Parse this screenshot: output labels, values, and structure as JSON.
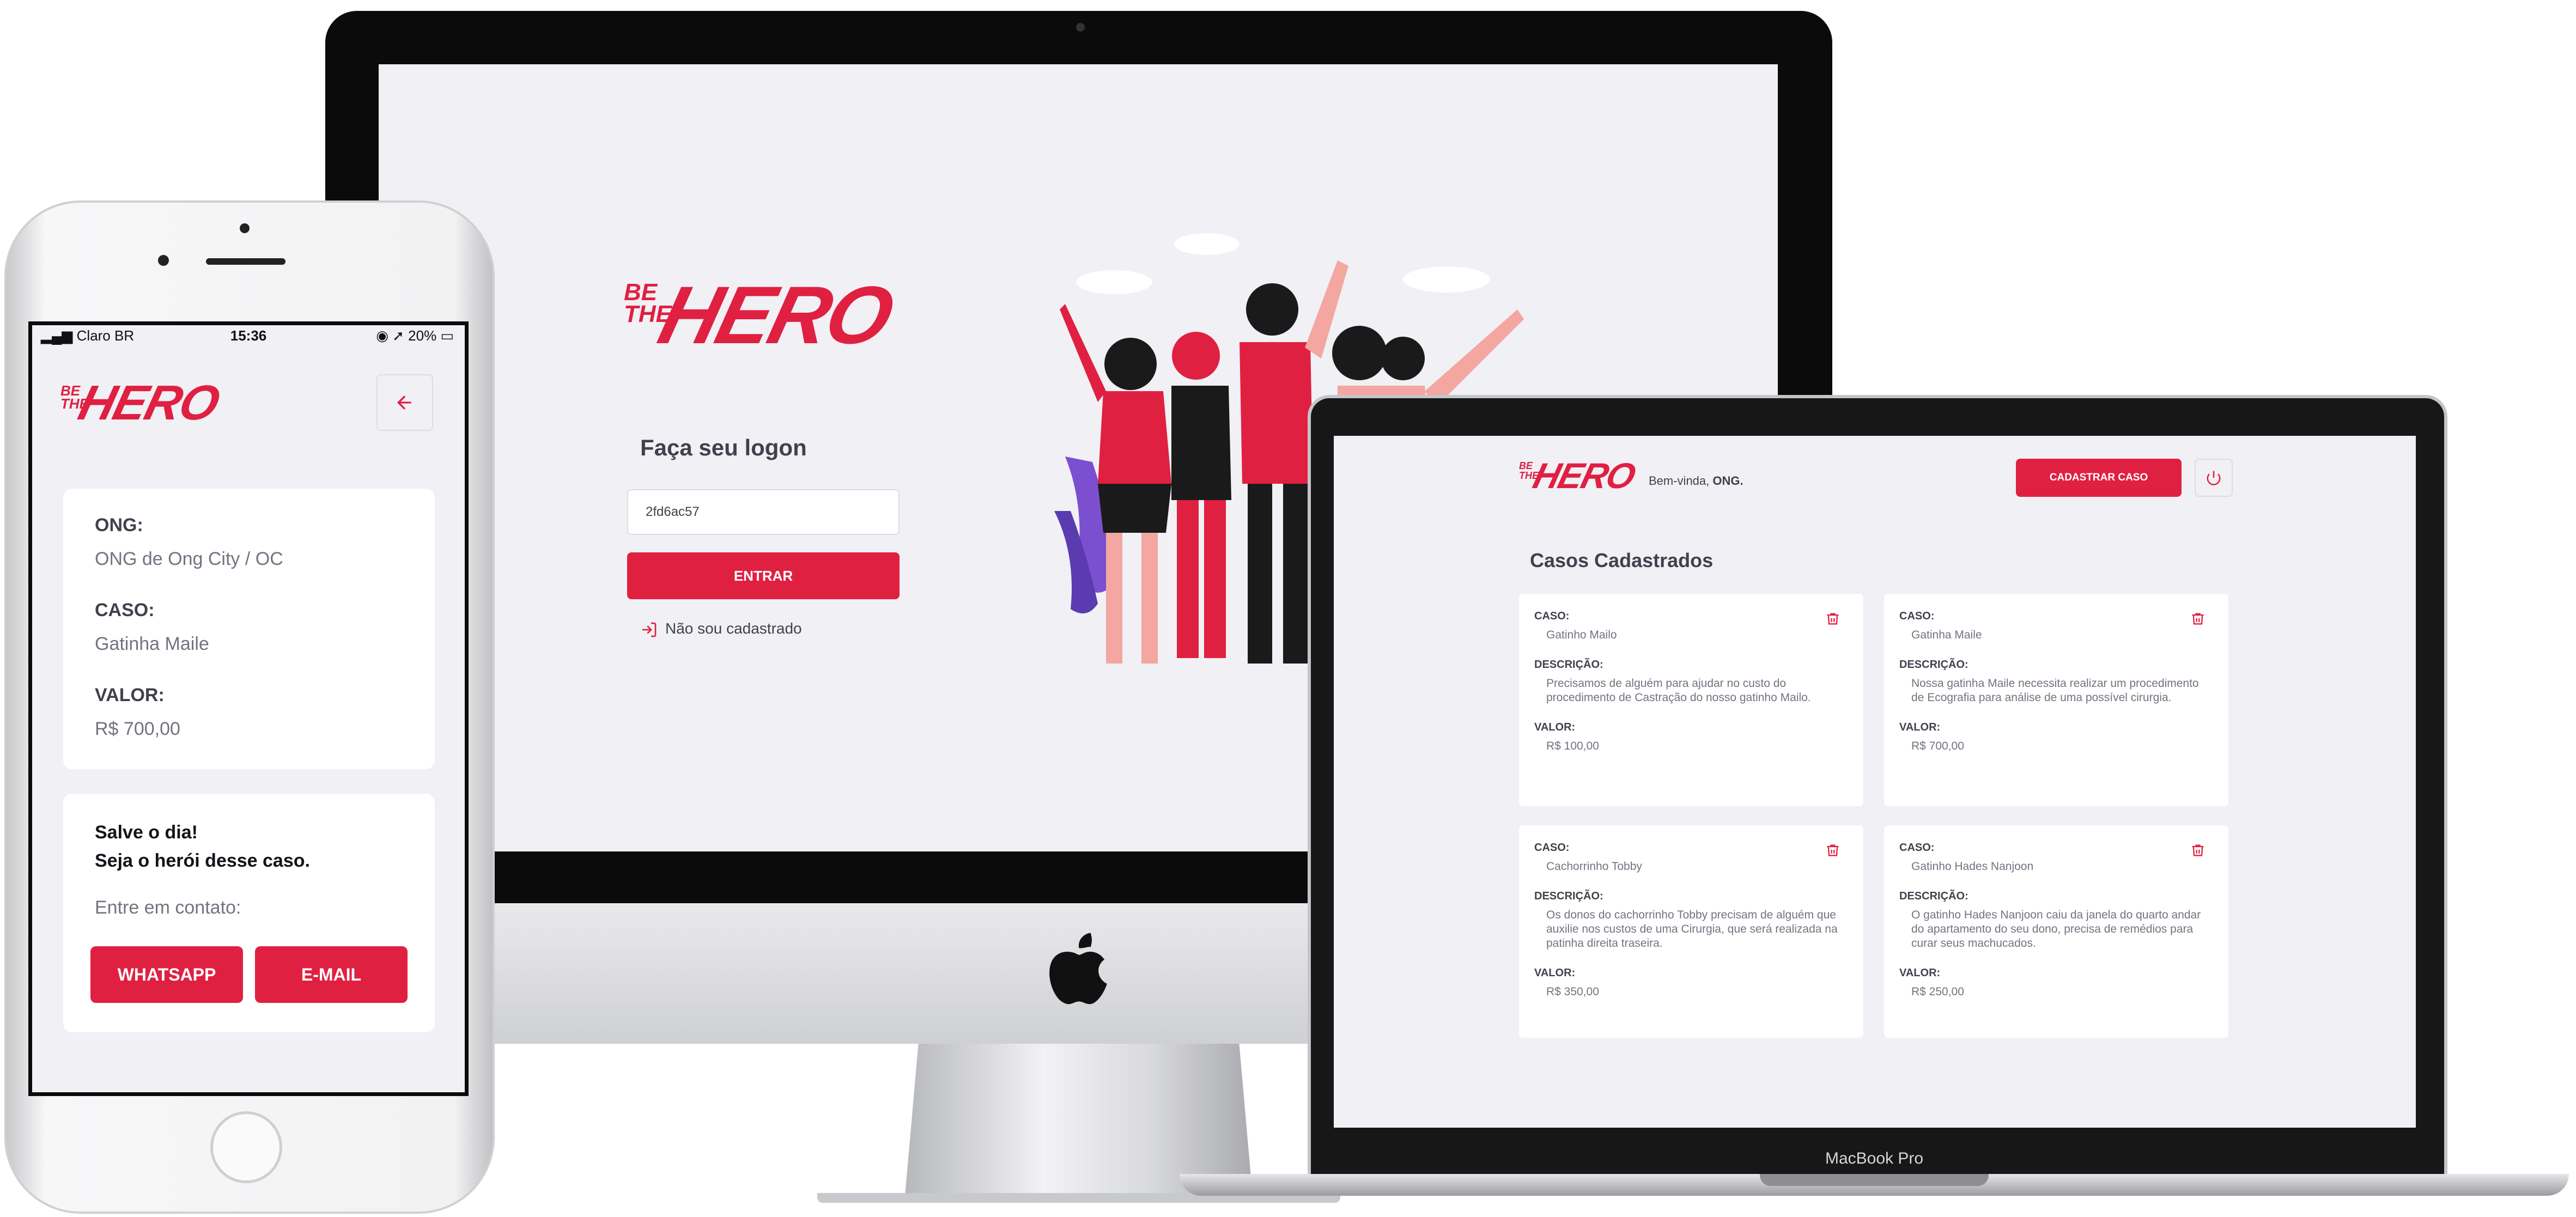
{
  "colors": {
    "accent": "#e02041",
    "background": "#f0f0f5",
    "text": "#41414d",
    "muted": "#737380"
  },
  "logo": {
    "small": "BE THE",
    "big": "HERO"
  },
  "desktop_login": {
    "title": "Faça seu logon",
    "id_value": "2fd6ac57",
    "submit_label": "ENTRAR",
    "register_link": "Não sou cadastrado",
    "register_icon": "log-in-icon"
  },
  "laptop_profile": {
    "welcome_prefix": "Bem-vinda, ",
    "ong_name": "ONG.",
    "new_case_label": "CADASTRAR CASO",
    "power_icon": "power-icon",
    "section_title": "Casos Cadastrados",
    "labels": {
      "caso": "CASO:",
      "descricao": "DESCRIÇÃO:",
      "valor": "VALOR:"
    },
    "cases": [
      {
        "title": "Gatinho Mailo",
        "description": "Precisamos de alguém para ajudar no custo do procedimento de Castração do nosso gatinho Mailo.",
        "value": "R$ 100,00"
      },
      {
        "title": "Gatinha Maile",
        "description": "Nossa gatinha Maile necessita realizar um procedimento de Ecografia para análise de uma possível cirurgia.",
        "value": "R$ 700,00"
      },
      {
        "title": "Cachorrinho Tobby",
        "description": "Os donos do cachorrinho Tobby precisam de alguém que auxilie nos custos de uma Cirurgia, que será realizada na patinha direita traseira.",
        "value": "R$ 350,00"
      },
      {
        "title": "Gatinho Hades Nanjoon",
        "description": "O gatinho Hades Nanjoon caiu da janela do quarto andar do apartamento do seu dono, precisa de remédios para curar seus machucados.",
        "value": "R$ 250,00"
      }
    ]
  },
  "laptop_brand": "MacBook Pro",
  "phone_status": {
    "carrier": "Claro BR",
    "time": "15:36",
    "battery": "20%"
  },
  "phone_detail": {
    "back_icon": "arrow-left-icon",
    "ong_label": "ONG:",
    "ong_value": "ONG de Ong City / OC",
    "case_label": "CASO:",
    "case_value": "Gatinha Maile",
    "value_label": "VALOR:",
    "value_value": "R$ 700,00",
    "cta_line1": "Salve o dia!",
    "cta_line2": "Seja o herói desse caso.",
    "contact_label": "Entre em contato:",
    "whatsapp_label": "WHATSAPP",
    "email_label": "E-MAIL"
  }
}
